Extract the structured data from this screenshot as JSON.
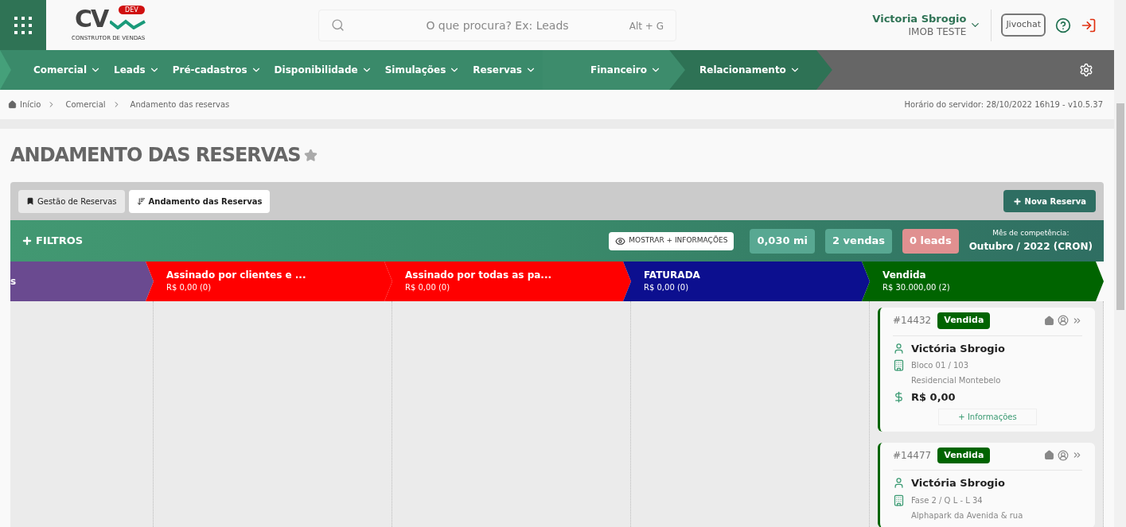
{
  "header": {
    "brand": "CV",
    "brand_badge": "DEV",
    "brand_tagline": "CONSTRUTOR DE VENDAS",
    "search": {
      "placeholder": "O que procura? Ex: Leads",
      "shortcut": "Alt + G"
    },
    "user": {
      "name": "Victoria Sbrogio",
      "company": "IMOB TESTE"
    },
    "chat_button": "Jivochat"
  },
  "nav": [
    {
      "label": "Comercial",
      "color": "#3a8a6a"
    },
    {
      "label": "Leads",
      "color": "#3a8a6a"
    },
    {
      "label": "Pré-cadastros",
      "color": "#3a8a6a"
    },
    {
      "label": "Disponibilidade",
      "color": "#3a8a6a"
    },
    {
      "label": "Simulações",
      "color": "#3a8a6a"
    },
    {
      "label": "Reservas",
      "color": "#3a8a6a"
    },
    {
      "label": "Financeiro",
      "color": "#3d8c6c"
    },
    {
      "label": "Relacionamento",
      "color": "#2e7255"
    }
  ],
  "breadcrumb": [
    "Início",
    "Comercial",
    "Andamento das reservas"
  ],
  "server_time": "Horário do servidor: 28/10/2022 16h19 - v10.5.37",
  "page_title": "ANDAMENTO DAS RESERVAS",
  "view_tabs": [
    {
      "label": "Gestão de Reservas",
      "selected": false
    },
    {
      "label": "Andamento das Reservas",
      "selected": true
    }
  ],
  "new_button": "Nova Reserva",
  "filters": {
    "label": "FILTROS",
    "show_more": "MOSTRAR + INFORMAÇÕES",
    "stats": [
      {
        "value": "0,030 mi",
        "color": "#58a892"
      },
      {
        "value": "2 vendas",
        "color": "#58a892"
      },
      {
        "value": "0 leads",
        "color": "#e09090"
      }
    ],
    "month_label": "Mês de competência:",
    "month": "Outubro / 2022 (CRON)"
  },
  "stages": [
    {
      "title": "s",
      "color": "#6a4a90"
    },
    {
      "title": "Assinado por clientes e ...",
      "total": "R$ 0,00 (0)",
      "color": "#ff0000"
    },
    {
      "title": "Assinado por todas as pa...",
      "total": "R$ 0,00 (0)",
      "color": "#ff0000"
    },
    {
      "title": "FATURADA",
      "total": "R$ 0,00 (0)",
      "color": "#0c0f8f"
    },
    {
      "title": "Vendida",
      "total": "R$ 30.000,00 (2)",
      "color": "#006400",
      "cards": [
        {
          "id": "#14432",
          "status": "Vendida",
          "name": "Victória Sbrogio",
          "unit": "Bloco 01 / 103",
          "project": "Residencial Montebelo",
          "value": "R$ 0,00",
          "more": "+ Informações"
        },
        {
          "id": "#14477",
          "status": "Vendida",
          "name": "Victória Sbrogio",
          "unit": "Fase 2 / Q L - L 34",
          "project": "Alphapark da Avenida & rua"
        }
      ]
    }
  ]
}
